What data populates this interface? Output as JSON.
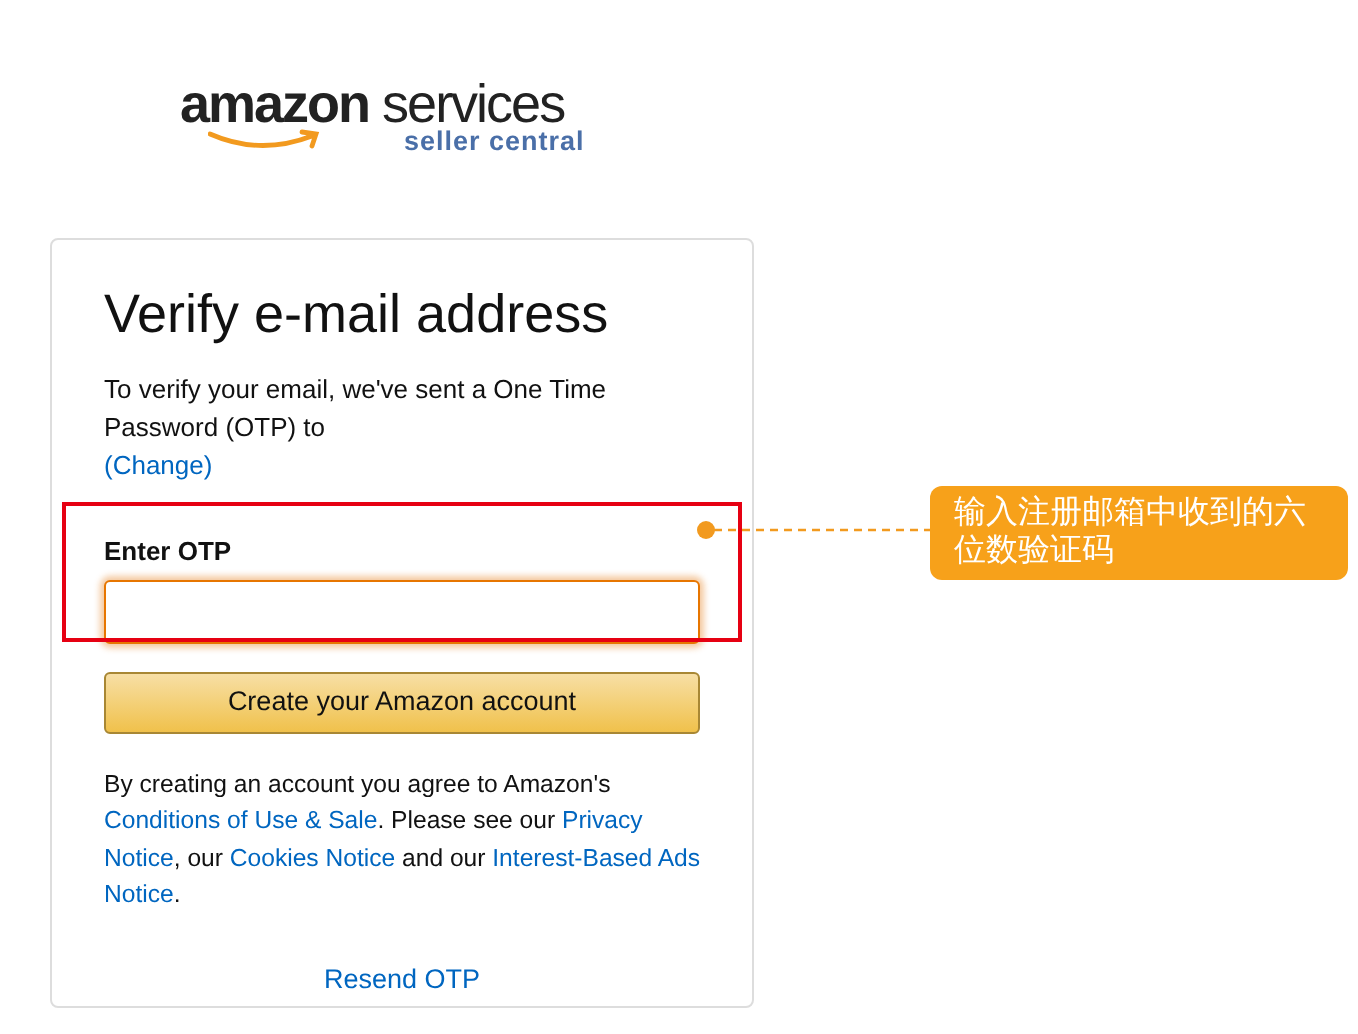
{
  "logo": {
    "brand": "amazon",
    "product": "services",
    "tagline": "seller central"
  },
  "card": {
    "title": "Verify e-mail address",
    "message": "To verify your email, we've sent a One Time Password (OTP) to",
    "change_link": "(Change)",
    "otp_field": {
      "label": "Enter OTP",
      "focused": true
    },
    "submit_button": "Create your Amazon account",
    "legal_lines": [
      [
        {
          "kind": "text",
          "text": "By creating an account you agree to Amazon's"
        }
      ],
      [
        {
          "kind": "link",
          "text": "Conditions of Use & Sale"
        },
        {
          "kind": "text",
          "text": ". Please see our "
        },
        {
          "kind": "link",
          "text": "Privacy"
        }
      ],
      [
        {
          "kind": "link",
          "text": "Notice"
        },
        {
          "kind": "text",
          "text": ", our "
        },
        {
          "kind": "link",
          "text": "Cookies Notice"
        },
        {
          "kind": "text",
          "text": " and our "
        },
        {
          "kind": "link",
          "text": "Interest-Based Ads"
        }
      ],
      [
        {
          "kind": "link",
          "text": "Notice"
        },
        {
          "kind": "text",
          "text": "."
        }
      ]
    ],
    "resend_link": "Resend OTP"
  },
  "annotation": {
    "text": "输入注册邮箱中收到的六位数验证码"
  }
}
